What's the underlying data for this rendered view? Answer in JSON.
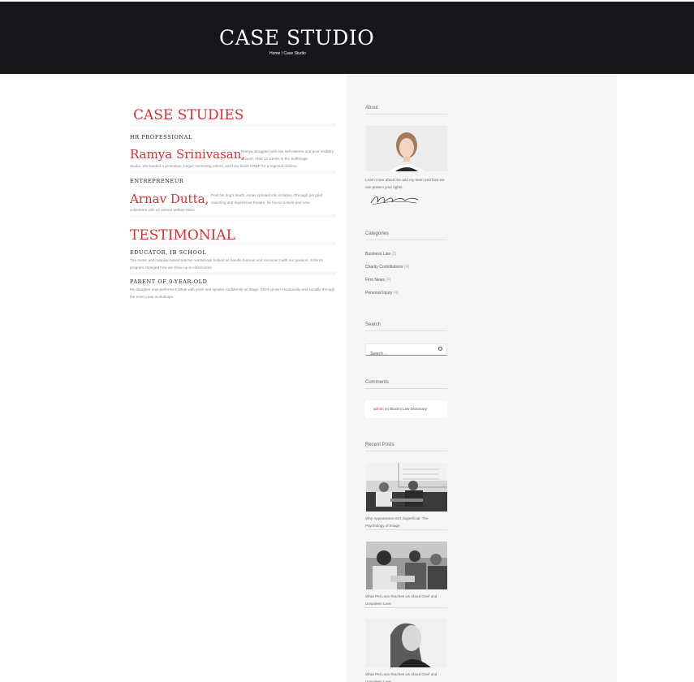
{
  "header": {
    "title": "CASE STUDIO",
    "breadcrumb_home": "Home",
    "breadcrumb_sep": "/",
    "breadcrumb_current": "Case Studio"
  },
  "case_studies": {
    "title": "CASE STUDIES",
    "items": [
      {
        "eyebrow": "HR PROFESSIONAL",
        "name": "Ramya Srinivasan,",
        "text_side": "Ramya struggled with low self-esteem and poor visibility at work. After 12 weeks in the SelfImage",
        "text_full": "Studio, she landed a promotion, began mentoring others, and now leads HRBP for a regional division."
      },
      {
        "eyebrow": "ENTREPRENEUR",
        "name": "Arnav Dutta,",
        "text_side": "Post his dog's death, Arnav spiraled into isolation. Through pet grief coaching and expressive theatre, he found closure and now",
        "text_full": "volunteers with an animal welfare NGO."
      }
    ]
  },
  "testimonial": {
    "title": "TESTIMONIAL",
    "items": [
      {
        "head": "EDUCATOR, IB SCHOOL",
        "text": "The music and roleplay-based teacher workshops helped us handle burnout and reconnect with our passion. Sohini's program changed how we show up in classrooms."
      },
      {
        "head": "PARENT OF 9-YEAR-OLD",
        "text": "My daughter now performs Kathak with pride and speaks confidently on stage. She's grown emotionally and socially through the Inner Leap workshops."
      }
    ]
  },
  "sidebar": {
    "about": {
      "title": "About",
      "text": "Learn more about me and my team and how we can protect your rights.",
      "signature": "M. Brank"
    },
    "categories": {
      "title": "Categories",
      "items": [
        {
          "label": "Business Law",
          "count": "(3)"
        },
        {
          "label": "Charity Contributions",
          "count": "(4)"
        },
        {
          "label": "Firm News",
          "count": "(4)"
        },
        {
          "label": "Personal Injury",
          "count": "(4)"
        }
      ]
    },
    "search": {
      "title": "Search",
      "placeholder": "Search ..."
    },
    "comments": {
      "title": "Comments",
      "author": "admin",
      "on": "on",
      "post": "Black's Law Dictionary"
    },
    "recent_posts": {
      "title": "Recent Posts",
      "items": [
        {
          "caption": "Why Appearance Isn't Superficial: The Psychology of Image"
        },
        {
          "caption": "What Pet Loss Teaches Us About Grief and Unspoken Love"
        },
        {
          "caption": "What Pet Loss Teaches Us About Grief and Unspoken Love"
        }
      ]
    }
  },
  "colors": {
    "accent": "#c7363a",
    "header_bg": "#17161b",
    "sidebar_bg": "#f6f6f6"
  }
}
